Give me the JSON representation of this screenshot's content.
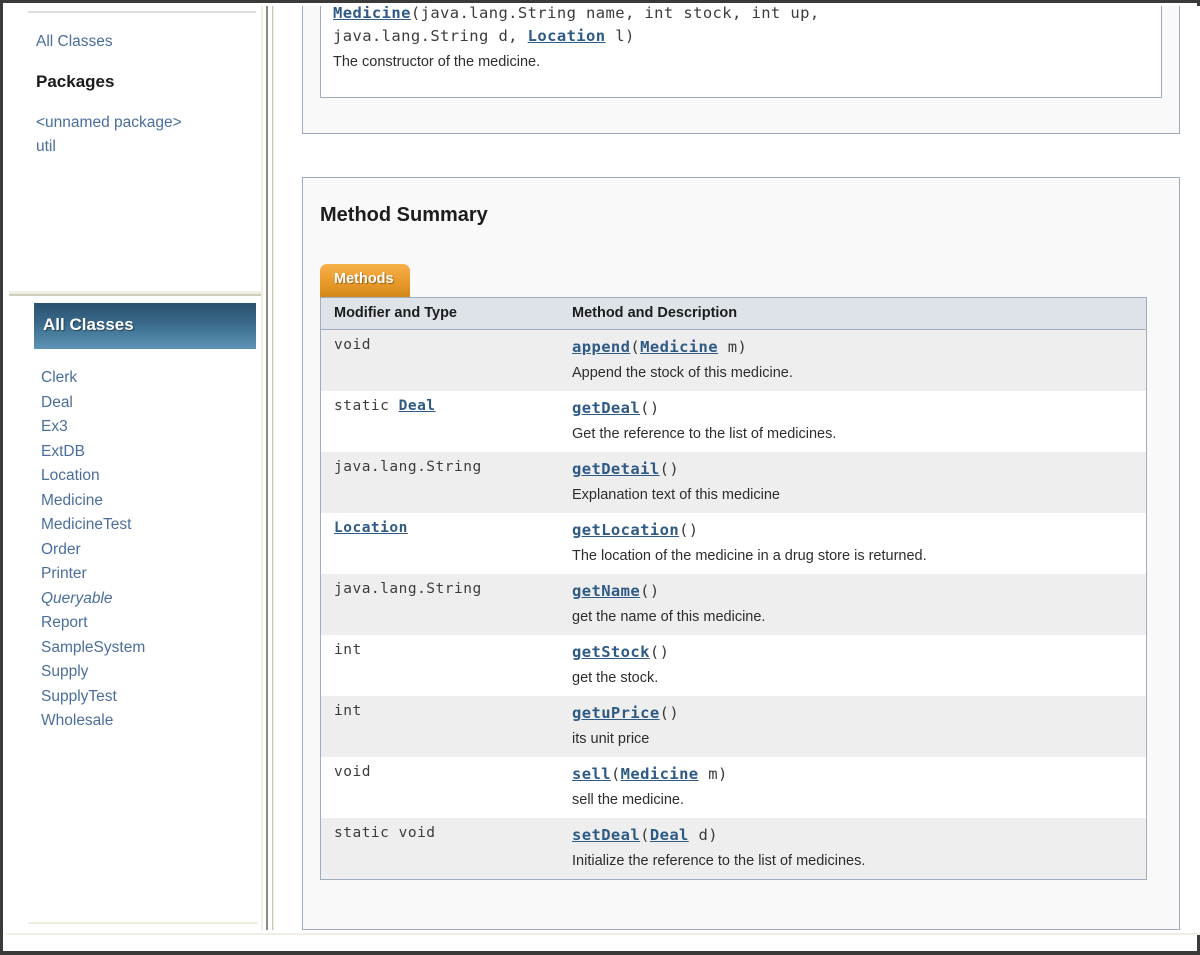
{
  "left_frame": {
    "all_classes_top_link": "All Classes",
    "packages_heading": "Packages",
    "packages": [
      {
        "label": "<unnamed package>"
      },
      {
        "label": "util"
      }
    ],
    "all_classes_panel": {
      "title": "All Classes",
      "classes": [
        {
          "label": "Clerk",
          "kind": "class"
        },
        {
          "label": "Deal",
          "kind": "class"
        },
        {
          "label": "Ex3",
          "kind": "class"
        },
        {
          "label": "ExtDB",
          "kind": "class"
        },
        {
          "label": "Location",
          "kind": "class"
        },
        {
          "label": "Medicine",
          "kind": "class"
        },
        {
          "label": "MedicineTest",
          "kind": "class"
        },
        {
          "label": "Order",
          "kind": "class"
        },
        {
          "label": "Printer",
          "kind": "class"
        },
        {
          "label": "Queryable",
          "kind": "interface"
        },
        {
          "label": "Report",
          "kind": "class"
        },
        {
          "label": "SampleSystem",
          "kind": "class"
        },
        {
          "label": "Supply",
          "kind": "class"
        },
        {
          "label": "SupplyTest",
          "kind": "class"
        },
        {
          "label": "Wholesale",
          "kind": "class"
        }
      ]
    }
  },
  "content": {
    "constructor_entry": {
      "signature_line1_pre": "",
      "signature_link": "Medicine",
      "signature_line1_post": "(java.lang.String name, int stock, int up,",
      "signature_line2_pre": "java.lang.String d, ",
      "signature_line2_link": "Location",
      "signature_line2_post": " l)",
      "description": "The constructor of the medicine."
    },
    "method_summary": {
      "title": "Method Summary",
      "tab_label": "Methods",
      "columns": {
        "type": "Modifier and Type",
        "method": "Method and Description"
      },
      "rows": [
        {
          "type_pre": "void",
          "type_link": "",
          "type_post": "",
          "method_link": "append",
          "method_args_pre": "(",
          "method_args_link": "Medicine",
          "method_args_post": " m)",
          "description": "Append the stock of this medicine."
        },
        {
          "type_pre": "static ",
          "type_link": "Deal",
          "type_post": "",
          "method_link": "getDeal",
          "method_args_pre": "(",
          "method_args_link": "",
          "method_args_post": ")",
          "description": "Get the reference to the list of medicines."
        },
        {
          "type_pre": "java.lang.String",
          "type_link": "",
          "type_post": "",
          "method_link": "getDetail",
          "method_args_pre": "(",
          "method_args_link": "",
          "method_args_post": ")",
          "description": "Explanation text of this medicine"
        },
        {
          "type_pre": "",
          "type_link": "Location",
          "type_post": "",
          "method_link": "getLocation",
          "method_args_pre": "(",
          "method_args_link": "",
          "method_args_post": ")",
          "description": "The location of the medicine in a drug store is returned."
        },
        {
          "type_pre": "java.lang.String",
          "type_link": "",
          "type_post": "",
          "method_link": "getName",
          "method_args_pre": "(",
          "method_args_link": "",
          "method_args_post": ")",
          "description": "get the name of this medicine."
        },
        {
          "type_pre": "int",
          "type_link": "",
          "type_post": "",
          "method_link": "getStock",
          "method_args_pre": "(",
          "method_args_link": "",
          "method_args_post": ")",
          "description": "get the stock."
        },
        {
          "type_pre": "int",
          "type_link": "",
          "type_post": "",
          "method_link": "getuPrice",
          "method_args_pre": "(",
          "method_args_link": "",
          "method_args_post": ")",
          "description": "its unit price"
        },
        {
          "type_pre": "void",
          "type_link": "",
          "type_post": "",
          "method_link": "sell",
          "method_args_pre": "(",
          "method_args_link": "Medicine",
          "method_args_post": " m)",
          "description": "sell the medicine."
        },
        {
          "type_pre": "static void",
          "type_link": "",
          "type_post": "",
          "method_link": "setDeal",
          "method_args_pre": "(",
          "method_args_link": "Deal",
          "method_args_post": " d)",
          "description": "Initialize the reference to the list of medicines."
        }
      ]
    }
  },
  "colors": {
    "link": "#4a6e9b",
    "member_link": "#2e5a85",
    "tab_orange_top": "#f6b14a",
    "tab_orange_bottom": "#d08516",
    "header_blue": "#dee3ea",
    "bar_blue_dark": "#2b516e",
    "alt_row": "#eeeeef",
    "panel_border": "#9eadc0"
  }
}
